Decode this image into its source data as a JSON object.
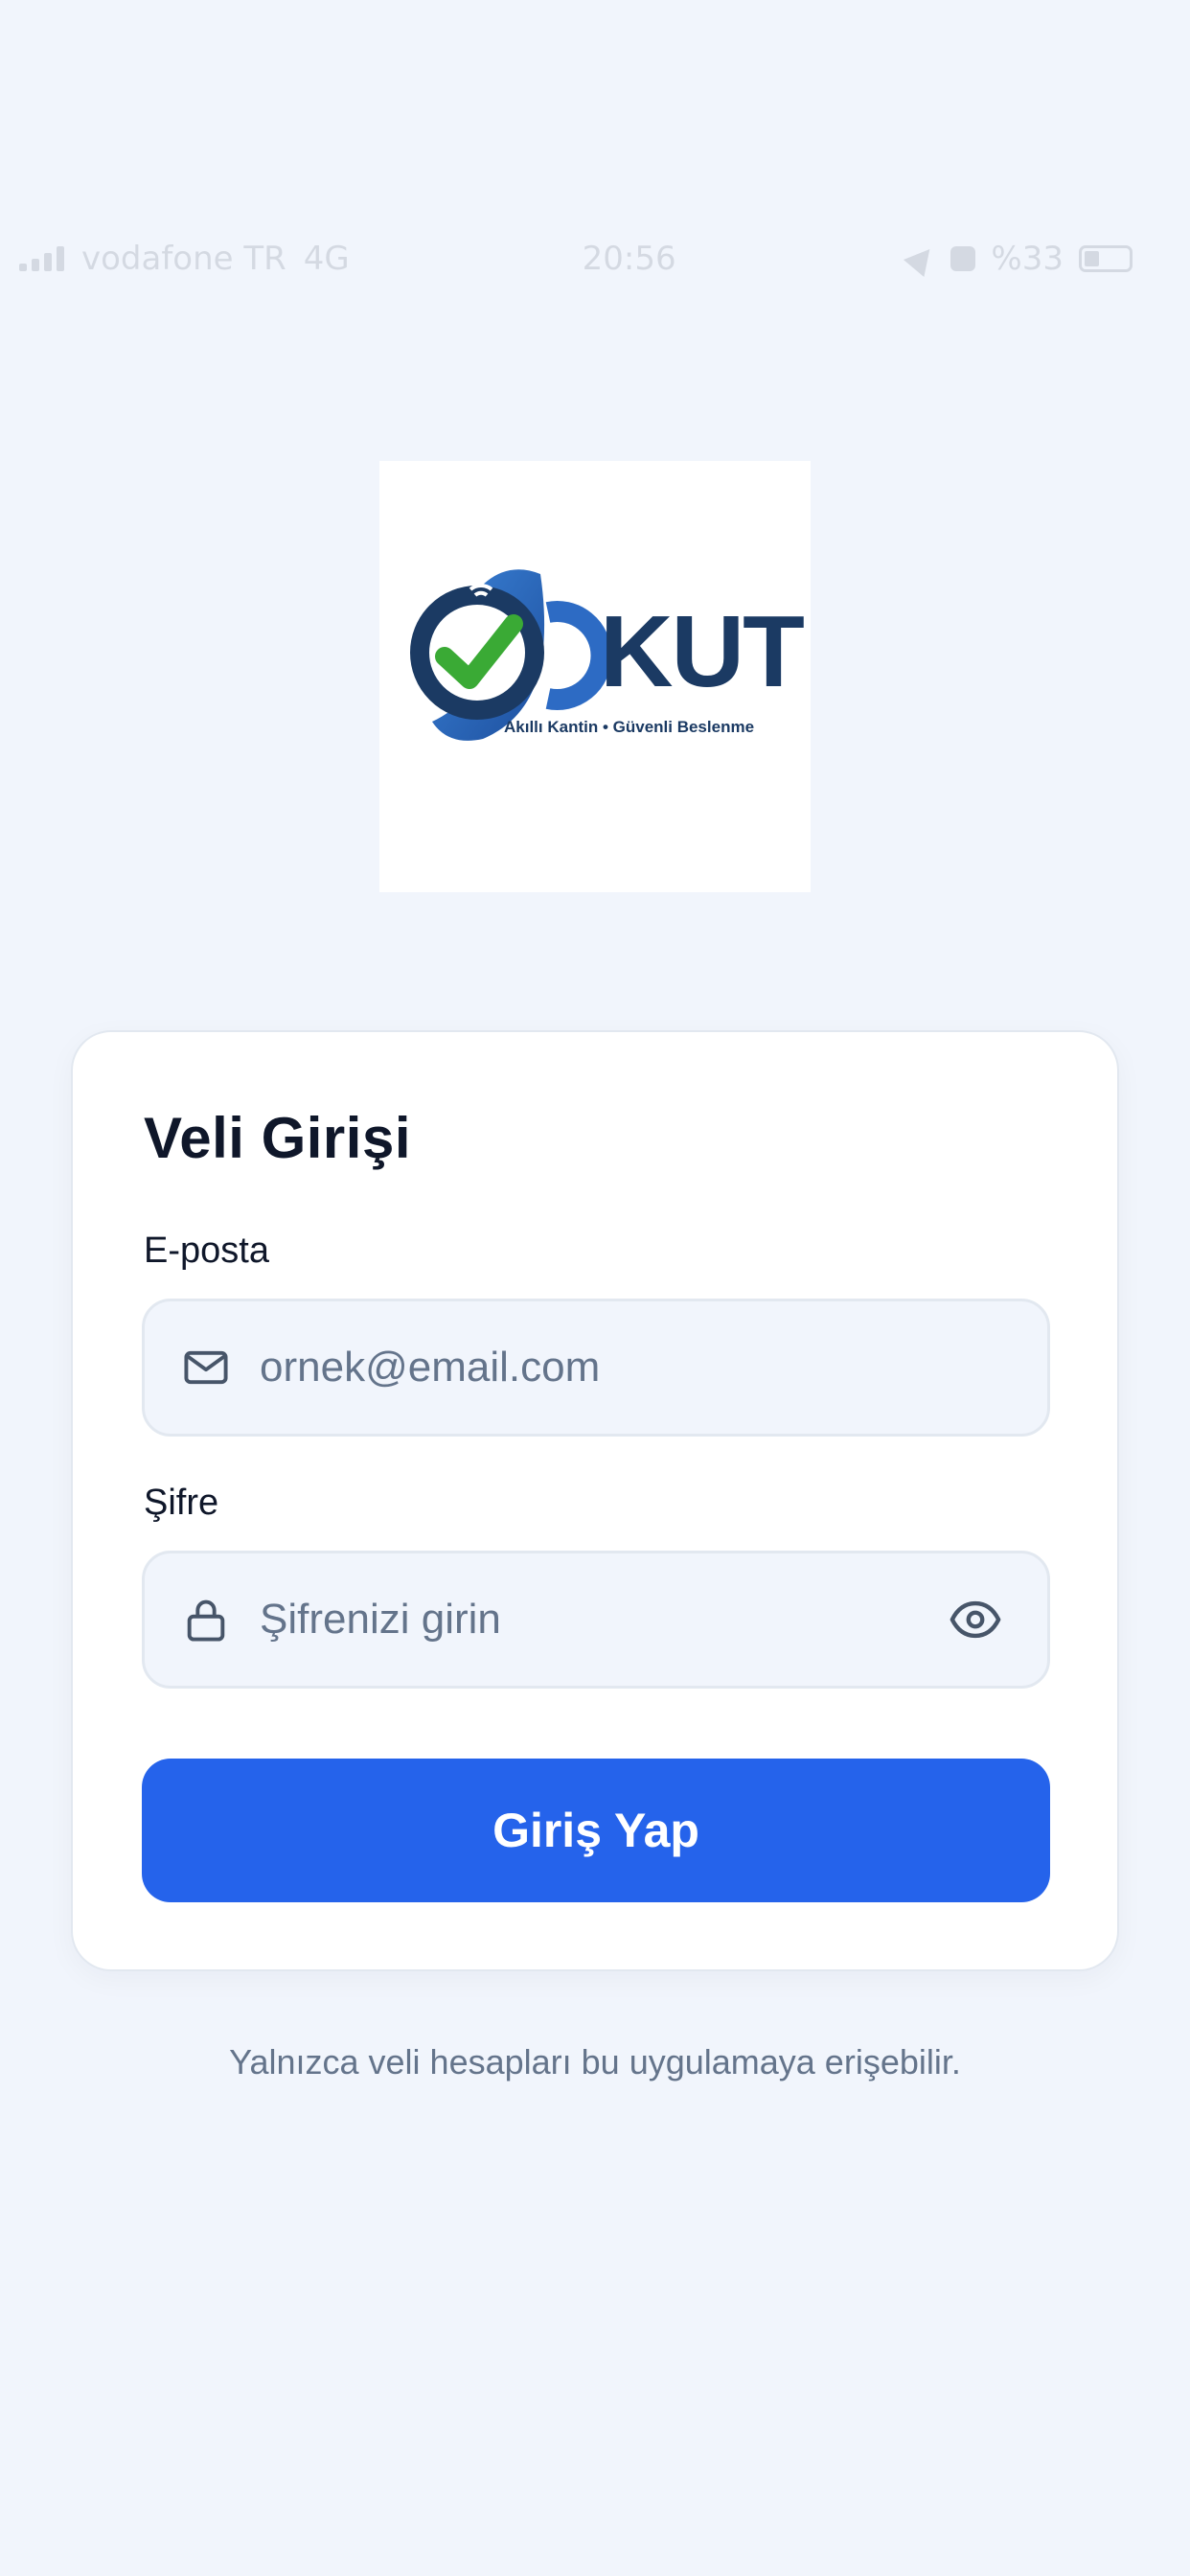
{
  "status_bar": {
    "carrier": "vodafone TR",
    "network": "4G",
    "time": "20:56",
    "battery": "%33"
  },
  "logo": {
    "wordmark": "KUT",
    "tagline": "Akıllı Kantin • Güvenli Beslenme",
    "icon": "smartwatch-check-icon",
    "colors": {
      "navy": "#1b3a63",
      "blue": "#2d6bc4",
      "green": "#3aaa35"
    }
  },
  "login_card": {
    "title": "Veli Girişi",
    "email": {
      "label": "E-posta",
      "placeholder": "ornek@email.com",
      "value": "",
      "icon": "mail-icon"
    },
    "password": {
      "label": "Şifre",
      "placeholder": "Şifrenizi girin",
      "value": "",
      "icon": "lock-icon",
      "toggle_icon": "eye-icon"
    },
    "submit_label": "Giriş Yap"
  },
  "footer_note": "Yalnızca veli hesapları bu uygulamaya erişebilir.",
  "colors": {
    "background": "#f1f5fc",
    "primary": "#2563eb",
    "text": "#0f172a",
    "muted": "#64748b"
  }
}
